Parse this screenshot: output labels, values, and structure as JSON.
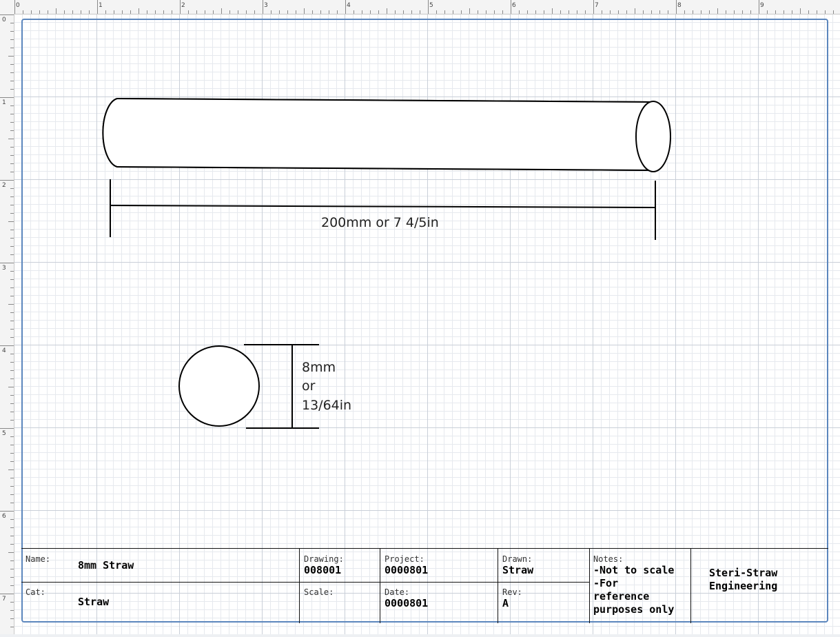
{
  "ruler": {
    "top_marks": [
      "0",
      "1",
      "2",
      "3",
      "4",
      "5",
      "6",
      "7",
      "8",
      "9"
    ],
    "left_marks": [
      "0",
      "1",
      "2",
      "3",
      "4",
      "5",
      "6",
      "7"
    ]
  },
  "dimensions": {
    "length_label": "200mm or 7 4/5in",
    "diameter_line1": "8mm",
    "diameter_line2": "or",
    "diameter_line3": "13/64in"
  },
  "title_block": {
    "name_label": "Name:",
    "name_value": "8mm Straw",
    "cat_label": "Cat:",
    "cat_value": "Straw",
    "drawing_label": "Drawing:",
    "drawing_value": "008001",
    "scale_label": "Scale:",
    "scale_value": "",
    "project_label": "Project:",
    "project_value": "0000801",
    "date_label": "Date:",
    "date_value": "0000801",
    "drawn_label": "Drawn:",
    "drawn_value": "Straw",
    "rev_label": "Rev:",
    "rev_value": "A",
    "notes_label": "Notes:",
    "notes_line1": "-Not to scale",
    "notes_line2": "-For",
    "notes_line3": "reference",
    "notes_line4": "purposes only",
    "company_line1": "Steri-Straw",
    "company_line2": "Engineering"
  },
  "colors": {
    "page_border": "#5b86bd",
    "grid_major": "#c9cfd8",
    "grid_minor": "#e6e9ee",
    "stroke": "#000000"
  }
}
